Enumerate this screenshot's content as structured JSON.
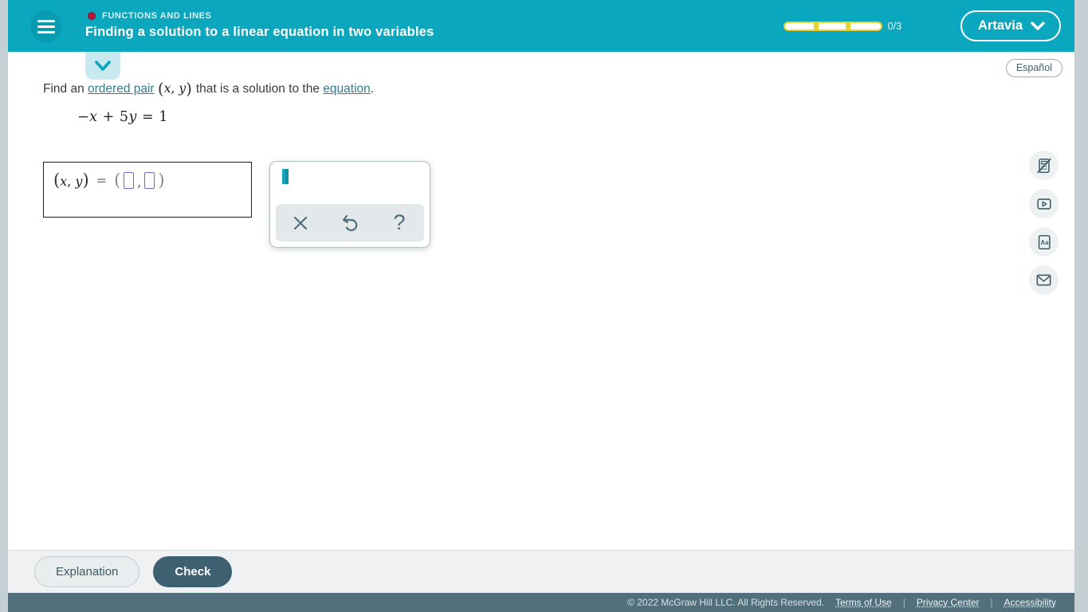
{
  "header": {
    "topic": "FUNCTIONS AND LINES",
    "title": "Finding a solution to a linear equation in two variables",
    "progress_label": "0/3",
    "user": "Artavia"
  },
  "language_button": "Español",
  "question": {
    "part1": "Find an",
    "link_ordered_pair": "ordered pair",
    "pair_open": "(",
    "pair_x": "x",
    "pair_comma": ",",
    "pair_y": "y",
    "pair_close": ")",
    "part2": "that is a solution to the",
    "link_equation": "equation",
    "period": "."
  },
  "equation": {
    "minus": "−",
    "x": "x",
    "plus_5": "+ 5",
    "y": "y",
    "equals_1": "= 1"
  },
  "answer_box": {
    "open": "(",
    "x": "x",
    "comma": ",",
    "y": "y",
    "close": ")",
    "equals": "=",
    "paren_open": "(",
    "input_comma": ",",
    "paren_close": ")"
  },
  "palette": {
    "help_label": "?"
  },
  "actions": {
    "explanation": "Explanation",
    "check": "Check"
  },
  "footer": {
    "copyright": "© 2022 McGraw Hill LLC. All Rights Reserved.",
    "terms": "Terms of Use",
    "sep1": "|",
    "privacy": "Privacy Center",
    "sep2": "|",
    "accessibility": "Accessibility"
  },
  "colors": {
    "header_teal": "#0aa7be",
    "footer_slate": "#51707b",
    "accent_yellow": "#e8d22c",
    "link_teal": "#2d7f8f",
    "input_blue": "#6a6ad4",
    "icon_slate": "#3e5d68"
  }
}
